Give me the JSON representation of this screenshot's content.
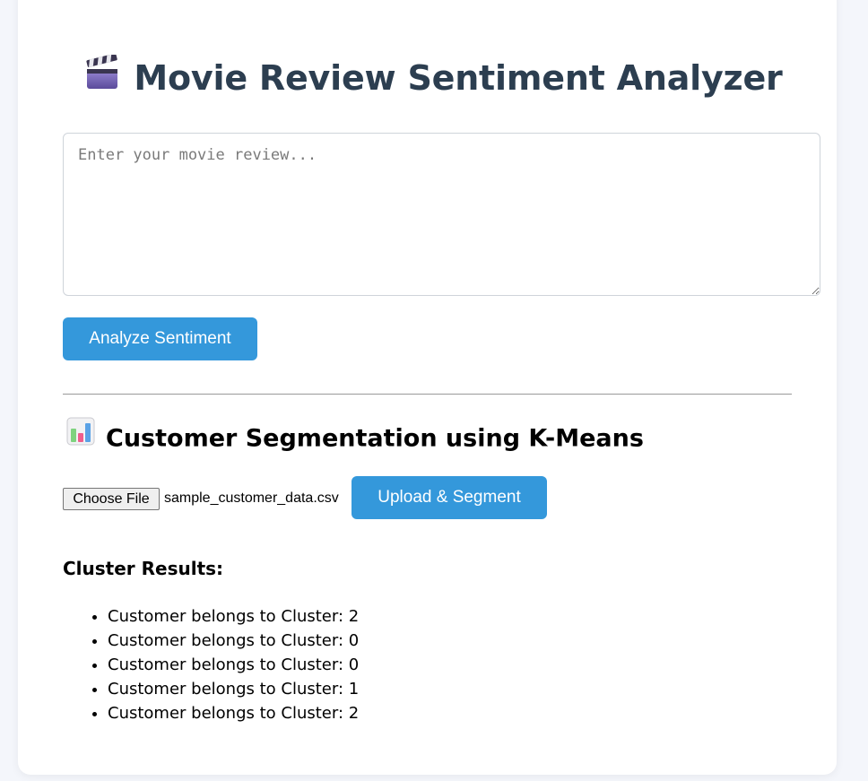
{
  "header": {
    "title": "Movie Review Sentiment Analyzer"
  },
  "review": {
    "placeholder": "Enter your movie review...",
    "value": ""
  },
  "analyze_button": {
    "label": "Analyze Sentiment"
  },
  "segmentation": {
    "title": "Customer Segmentation using K-Means",
    "choose_file_label": "Choose File",
    "file_name": "sample_customer_data.csv",
    "upload_label": "Upload & Segment"
  },
  "results": {
    "title": "Cluster Results:",
    "items": [
      "Customer belongs to Cluster: 2",
      "Customer belongs to Cluster: 0",
      "Customer belongs to Cluster: 0",
      "Customer belongs to Cluster: 1",
      "Customer belongs to Cluster: 2"
    ]
  },
  "colors": {
    "accent": "#3498db",
    "title": "#2c3e50",
    "background": "#f4f6fb"
  },
  "icons": {
    "title_icon": "clapperboard-icon",
    "section_icon": "bar-chart-icon"
  }
}
